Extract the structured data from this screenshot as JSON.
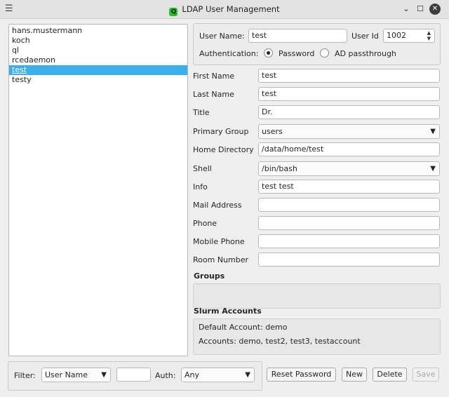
{
  "window": {
    "title": "LDAP User Management",
    "logo_letter": "Q",
    "menu_glyph": "☰",
    "minimize_glyph": "⌄",
    "maximize_glyph": "☐",
    "close_glyph": "✕"
  },
  "users": [
    "hans.mustermann",
    "koch",
    "ql",
    "rcedaemon",
    "test",
    "testy"
  ],
  "selected_user": "test",
  "account": {
    "username_label": "User Name:",
    "username": "test",
    "userid_label": "User Id",
    "userid": "1002",
    "auth_label": "Authentication:",
    "auth_password": "Password",
    "auth_ad": "AD passthrough",
    "auth_selected": "Password"
  },
  "fields": {
    "first_name": {
      "label": "First Name",
      "value": "test"
    },
    "last_name": {
      "label": "Last Name",
      "value": "test"
    },
    "title": {
      "label": "Title",
      "value": "Dr."
    },
    "primary_group": {
      "label": "Primary Group",
      "value": "users"
    },
    "home_directory": {
      "label": "Home Directory",
      "value": "/data/home/test"
    },
    "shell": {
      "label": "Shell",
      "value": "/bin/bash"
    },
    "info": {
      "label": "Info",
      "value": "test test"
    },
    "mail_address": {
      "label": "Mail Address",
      "value": ""
    },
    "phone": {
      "label": "Phone",
      "value": ""
    },
    "mobile_phone": {
      "label": "Mobile Phone",
      "value": ""
    },
    "room_number": {
      "label": "Room Number",
      "value": ""
    }
  },
  "groups": {
    "title": "Groups"
  },
  "slurm": {
    "title": "Slurm Accounts",
    "default_account": "Default Account: demo",
    "accounts": "Accounts: demo, test2, test3, testaccount"
  },
  "filter": {
    "label": "Filter:",
    "field": "User Name",
    "value": "",
    "auth_label": "Auth:",
    "auth_value": "Any"
  },
  "buttons": {
    "reset_password": "Reset Password",
    "new": "New",
    "delete": "Delete",
    "save": "Save"
  },
  "colors": {
    "selection": "#3daee9",
    "app_icon": "#22c22b"
  }
}
